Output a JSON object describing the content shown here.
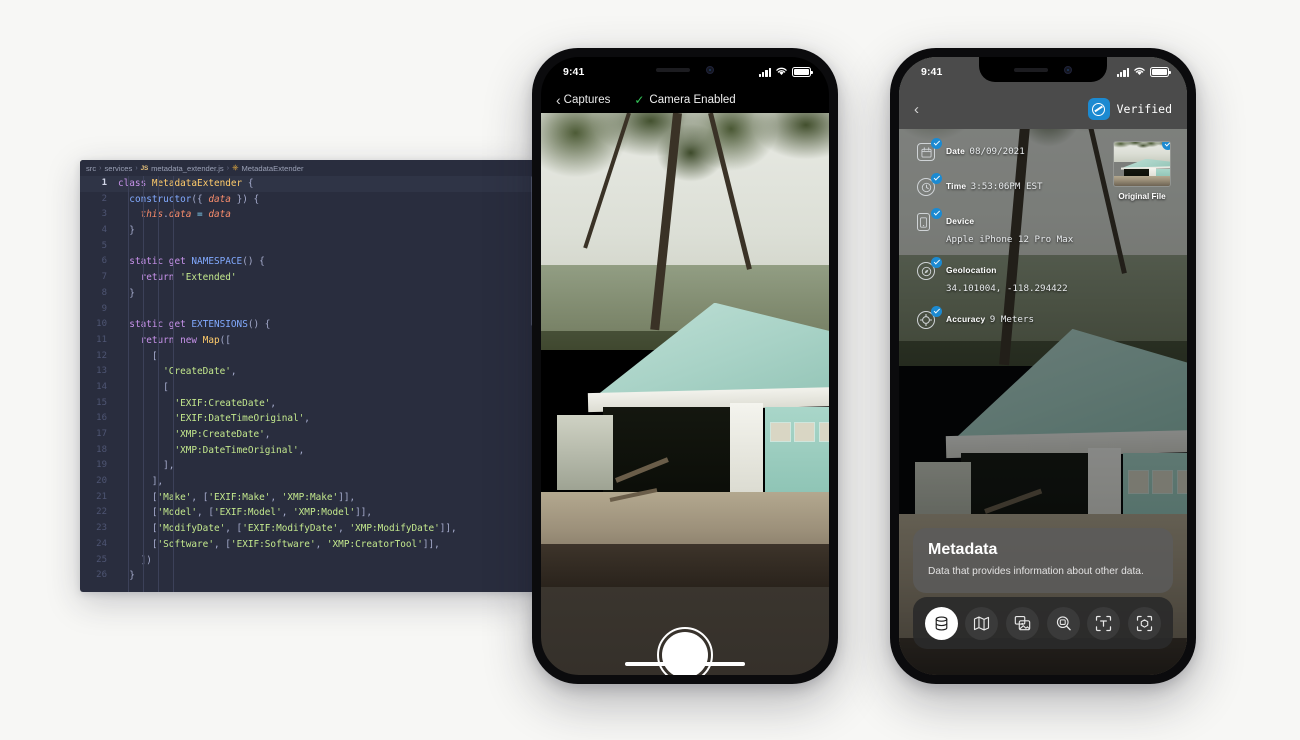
{
  "editor": {
    "breadcrumb": {
      "part1": "src",
      "part2": "services",
      "js_badge": "JS",
      "file": "metadata_extender.js",
      "symbol": "MetadataExtender",
      "separator": "›"
    },
    "lines": [
      {
        "n": "1",
        "active": true
      },
      {
        "n": "2",
        "active": false
      },
      {
        "n": "3",
        "active": false
      },
      {
        "n": "4",
        "active": false
      },
      {
        "n": "5",
        "active": false
      },
      {
        "n": "6",
        "active": false
      },
      {
        "n": "7",
        "active": false
      },
      {
        "n": "8",
        "active": false
      },
      {
        "n": "9",
        "active": false
      },
      {
        "n": "10",
        "active": false
      },
      {
        "n": "11",
        "active": false
      },
      {
        "n": "12",
        "active": false
      },
      {
        "n": "13",
        "active": false
      },
      {
        "n": "14",
        "active": false
      },
      {
        "n": "15",
        "active": false
      },
      {
        "n": "16",
        "active": false
      },
      {
        "n": "17",
        "active": false
      },
      {
        "n": "18",
        "active": false
      },
      {
        "n": "19",
        "active": false
      },
      {
        "n": "20",
        "active": false
      },
      {
        "n": "21",
        "active": false
      },
      {
        "n": "22",
        "active": false
      },
      {
        "n": "23",
        "active": false
      },
      {
        "n": "24",
        "active": false
      },
      {
        "n": "25",
        "active": false
      },
      {
        "n": "26",
        "active": false
      }
    ],
    "code_text": [
      "class MetadataExtender {",
      "  constructor({ data }) {",
      "    this.data = data",
      "  }",
      "",
      "  static get NAMESPACE() {",
      "    return 'Extended'",
      "  }",
      "",
      "  static get EXTENSIONS() {",
      "    return new Map([",
      "      [",
      "        'CreateDate',",
      "        [",
      "          'EXIF:CreateDate',",
      "          'EXIF:DateTimeOriginal',",
      "          'XMP:CreateDate',",
      "          'XMP:DateTimeOriginal',",
      "        ],",
      "      ],",
      "      ['Make', ['EXIF:Make', 'XMP:Make']],",
      "      ['Model', ['EXIF:Model', 'XMP:Model']],",
      "      ['ModifyDate', ['EXIF:ModifyDate', 'XMP:ModifyDate']],",
      "      ['Software', ['EXIF:Software', 'XMP:CreatorTool']],",
      "    ])",
      "  }"
    ]
  },
  "phone_camera": {
    "status": {
      "time": "9:41"
    },
    "back_label": "Captures",
    "back_chevron": "‹",
    "camera_status_label": "Camera Enabled",
    "camera_status_tick": "✓",
    "shutter_name": "shutter-button"
  },
  "phone_metadata": {
    "status": {
      "time": "9:41"
    },
    "back_chevron": "‹",
    "verified_label": "Verified",
    "rows": [
      {
        "icon": "calendar-icon",
        "label": "Date",
        "value": "08/09/2021"
      },
      {
        "icon": "clock-icon",
        "label": "Time",
        "value": "3:53:06PM EST"
      },
      {
        "icon": "phone-icon",
        "label": "Device",
        "value": "Apple iPhone 12 Pro Max"
      },
      {
        "icon": "compass-icon",
        "label": "Geolocation",
        "value": "34.101004, -118.294422"
      },
      {
        "icon": "crosshair-icon",
        "label": "Accuracy",
        "value": "9 Meters"
      }
    ],
    "original_file_label": "Original File",
    "card": {
      "title": "Metadata",
      "description": "Data that provides information about other data."
    },
    "toolbar": [
      {
        "icon": "database-icon",
        "label": "Metadata",
        "active": true
      },
      {
        "icon": "map-icon",
        "label": "Map",
        "active": false
      },
      {
        "icon": "photo-stack-icon",
        "label": "Photos",
        "active": false
      },
      {
        "icon": "magnify-exif-icon",
        "label": "Inspect",
        "active": false
      },
      {
        "icon": "text-scan-icon",
        "label": "Text Scan",
        "active": false
      },
      {
        "icon": "object-scan-icon",
        "label": "Object Scan",
        "active": false
      }
    ]
  },
  "colors": {
    "page_background": "#f7f7f5",
    "editor_background": "#292d3e",
    "accent_blue": "#1c8ad1",
    "status_green": "#34c759",
    "keyword_purple": "#c792ea",
    "class_yellow": "#ffcb6b",
    "string_green": "#c3e88d",
    "param_orange": "#f78c6c",
    "function_blue": "#82aaff"
  }
}
